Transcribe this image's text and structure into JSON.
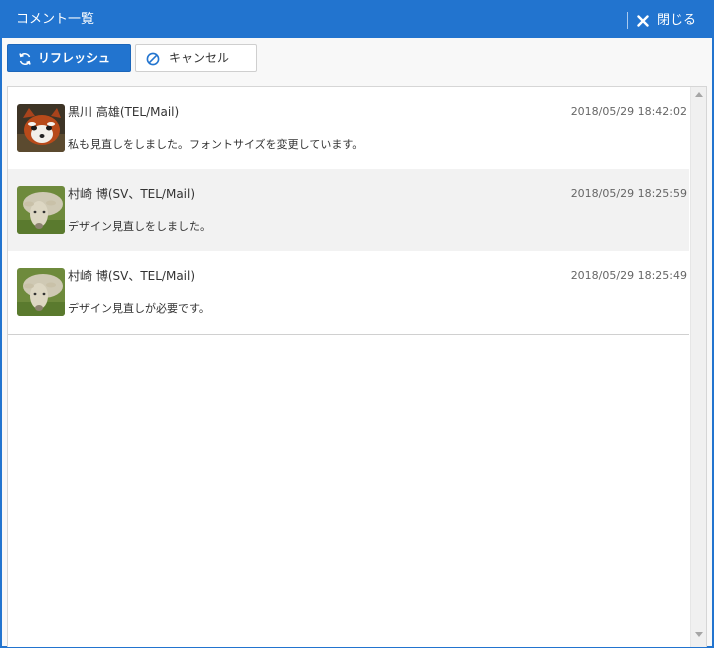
{
  "window": {
    "title": "コメント一覧",
    "close_label": "閉じる"
  },
  "toolbar": {
    "refresh_label": "リフレッシュ",
    "cancel_label": "キャンセル"
  },
  "comments": [
    {
      "author": "黒川 高雄(TEL/Mail)",
      "time": "2018/05/29 18:42:02",
      "text": "私も見直しをしました。フォントサイズを変更しています。",
      "avatar_icon": "red-panda-avatar-icon"
    },
    {
      "author": "村崎 博(SV、TEL/Mail)",
      "time": "2018/05/29 18:25:59",
      "text": "デザイン見直しをしました。",
      "avatar_icon": "sheep-avatar-icon"
    },
    {
      "author": "村崎 博(SV、TEL/Mail)",
      "time": "2018/05/29 18:25:49",
      "text": "デザイン見直しが必要です。",
      "avatar_icon": "sheep-avatar-icon"
    }
  ],
  "colors": {
    "accent": "#2274cf",
    "row_alt": "#f2f2f2"
  }
}
